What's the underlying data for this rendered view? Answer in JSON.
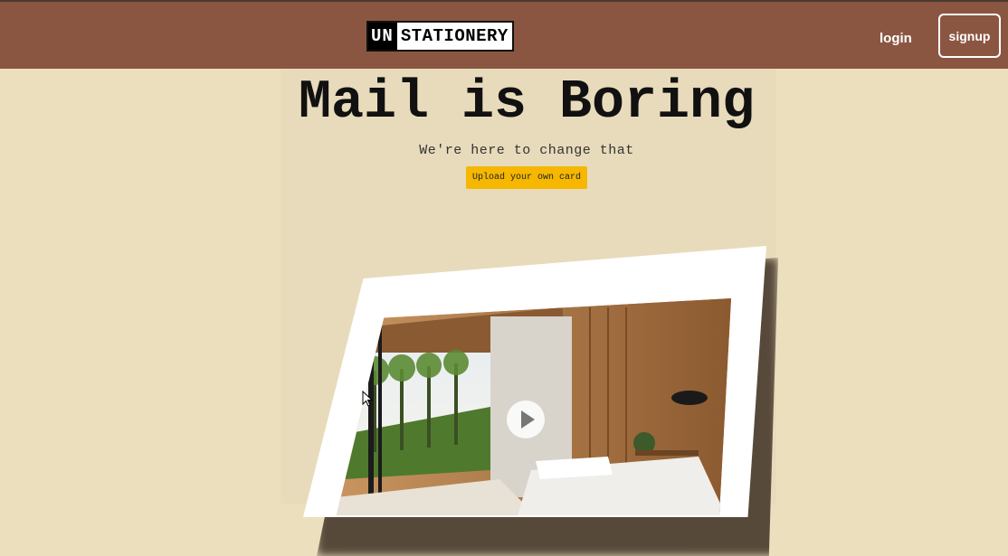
{
  "header": {
    "logo_un": "UN",
    "logo_rest": "STATIONERY",
    "login_label": "login",
    "signup_label": "signup"
  },
  "hero": {
    "title": "Mail is Boring",
    "subtitle": "We're here to change that",
    "upload_label": "Upload your own card"
  },
  "card": {
    "media_icon": "play-icon"
  },
  "colors": {
    "navbar": "#8b5641",
    "background": "#ecdfbd",
    "accent_button": "#f5b700"
  }
}
